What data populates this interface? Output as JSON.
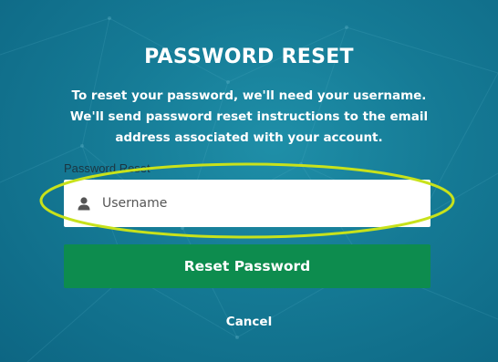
{
  "page": {
    "title": "PASSWORD RESET",
    "instructions": "To reset your password, we'll need your username. We'll send password reset instructions to the email address associated with your account."
  },
  "form": {
    "field_label": "Password Reset",
    "username_placeholder": "Username",
    "username_value": "",
    "username_icon": "user-icon",
    "submit_label": "Reset Password",
    "cancel_label": "Cancel"
  },
  "colors": {
    "background": "#157a95",
    "submit_button": "#0d8c4e",
    "highlight_ring": "#c8e21b"
  }
}
